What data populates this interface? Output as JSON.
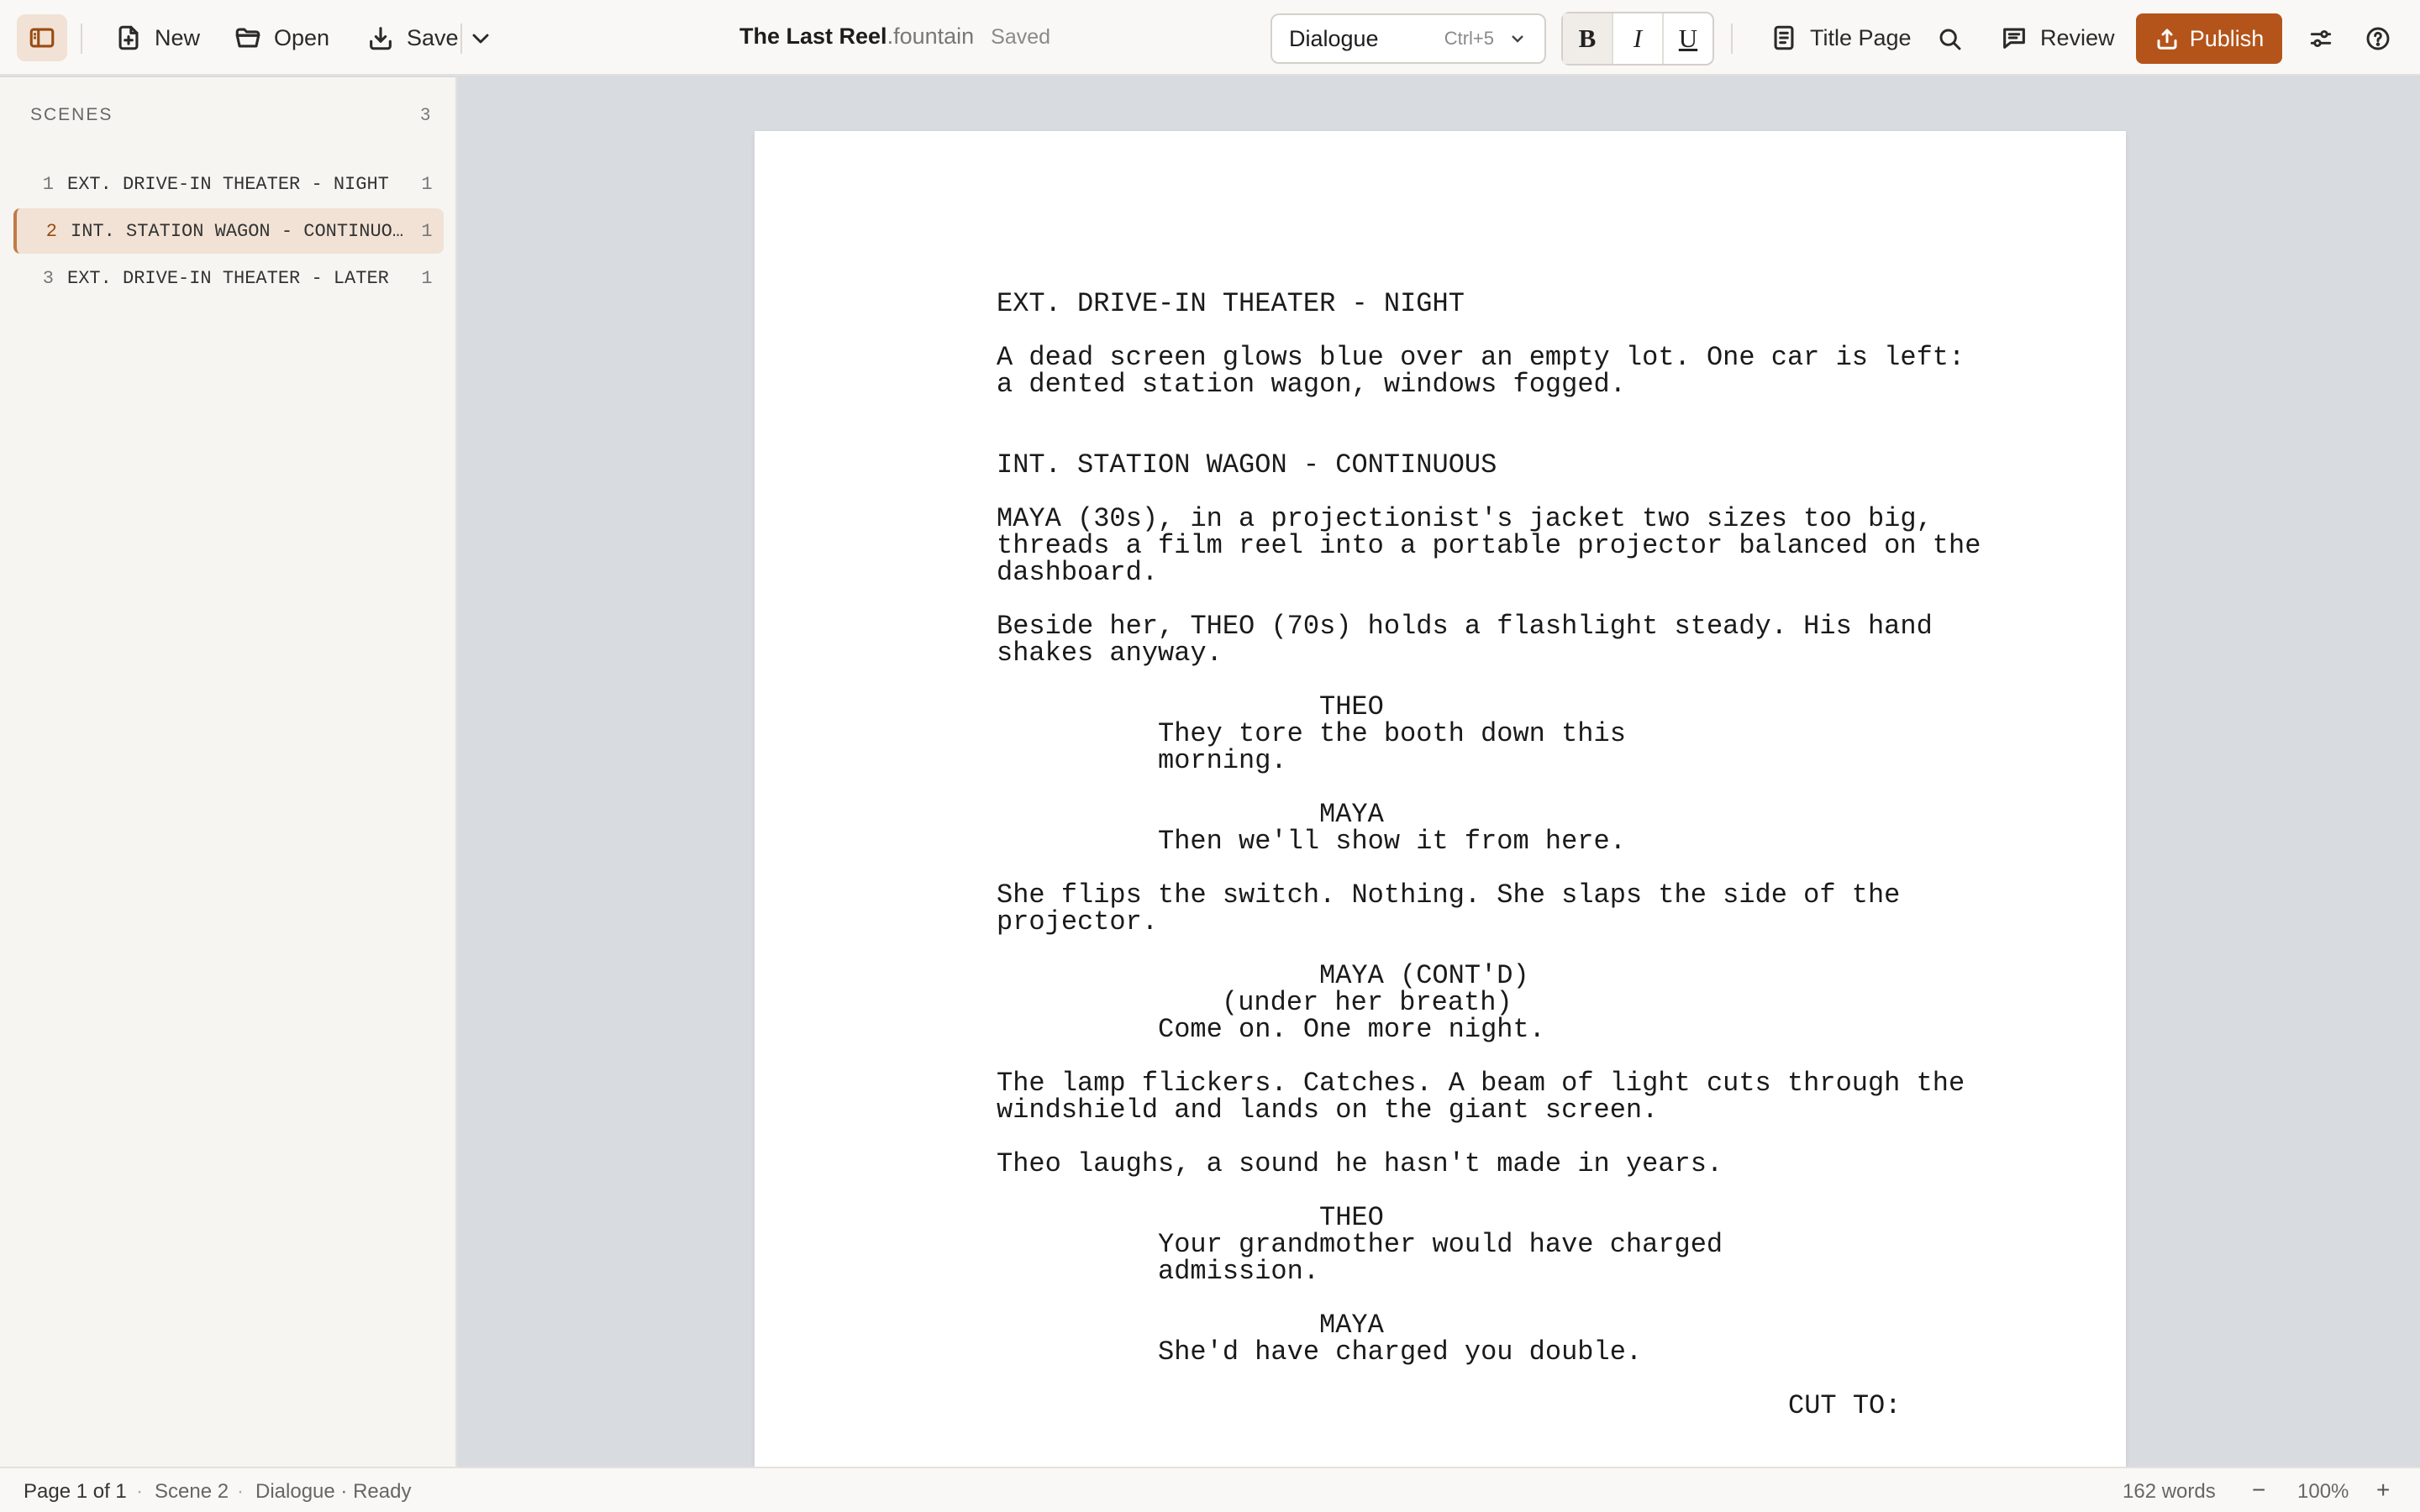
{
  "toolbar": {
    "new_label": "New",
    "open_label": "Open",
    "save_label": "Save",
    "document": {
      "name": "The Last Reel",
      "extension": ".fountain",
      "status": "Saved"
    },
    "element_style": {
      "value": "Dialogue",
      "shortcut": "Ctrl+5"
    },
    "format": {
      "bold": "B",
      "italic": "I",
      "underline": "U"
    },
    "title_page_label": "Title Page",
    "review_label": "Review",
    "publish_label": "Publish",
    "accent_color": "#b4541a"
  },
  "sidebar": {
    "header": "SCENES",
    "count": "3",
    "scenes": [
      {
        "num": "1",
        "title": "EXT. DRIVE-IN THEATER - NIGHT",
        "pages": "1",
        "active": false
      },
      {
        "num": "2",
        "title": "INT. STATION WAGON - CONTINUOUS",
        "pages": "1",
        "active": true
      },
      {
        "num": "3",
        "title": "EXT. DRIVE-IN THEATER - LATER",
        "pages": "1",
        "active": false
      }
    ]
  },
  "script": {
    "lines": [
      {
        "type": "scene",
        "text": "EXT. DRIVE-IN THEATER - NIGHT"
      },
      {
        "type": "action",
        "text": "A dead screen glows blue over an empty lot. One car is left:"
      },
      {
        "type": "action",
        "text": "a dented station wagon, windows fogged."
      },
      {
        "type": "scene",
        "text": "INT. STATION WAGON - CONTINUOUS"
      },
      {
        "type": "action",
        "text": "MAYA (30s), in a projectionist's jacket two sizes too big,"
      },
      {
        "type": "action",
        "text": "threads a film reel into a portable projector balanced on the"
      },
      {
        "type": "action",
        "text": "dashboard."
      },
      {
        "type": "action",
        "text": "Beside her, THEO (70s) holds a flashlight steady. His hand"
      },
      {
        "type": "action",
        "text": "shakes anyway."
      },
      {
        "type": "character",
        "text": "THEO"
      },
      {
        "type": "dialogue",
        "text": "They tore the booth down this"
      },
      {
        "type": "dialogue",
        "text": "morning."
      },
      {
        "type": "character",
        "text": "MAYA"
      },
      {
        "type": "dialogue",
        "text": "Then we'll show it from here."
      },
      {
        "type": "action",
        "text": "She flips the switch. Nothing. She slaps the side of the"
      },
      {
        "type": "action",
        "text": "projector."
      },
      {
        "type": "character",
        "text": "MAYA (CONT'D)"
      },
      {
        "type": "parenthetical",
        "text": "(under her breath)"
      },
      {
        "type": "dialogue",
        "text": "Come on. One more night."
      },
      {
        "type": "action",
        "text": "The lamp flickers. Catches. A beam of light cuts through the"
      },
      {
        "type": "action",
        "text": "windshield and lands on the giant screen."
      },
      {
        "type": "action",
        "text": "Theo laughs, a sound he hasn't made in years."
      },
      {
        "type": "character",
        "text": "THEO"
      },
      {
        "type": "dialogue",
        "text": "Your grandmother would have charged"
      },
      {
        "type": "dialogue",
        "text": "admission."
      },
      {
        "type": "character",
        "text": "MAYA"
      },
      {
        "type": "dialogue",
        "text": "She'd have charged you double."
      },
      {
        "type": "transition",
        "text": "CUT TO:"
      }
    ]
  },
  "status": {
    "page": "Page 1 of 1",
    "scene": "Scene 2",
    "mode": "Dialogue · Ready",
    "word_count": "162 words",
    "zoom": "100%"
  }
}
